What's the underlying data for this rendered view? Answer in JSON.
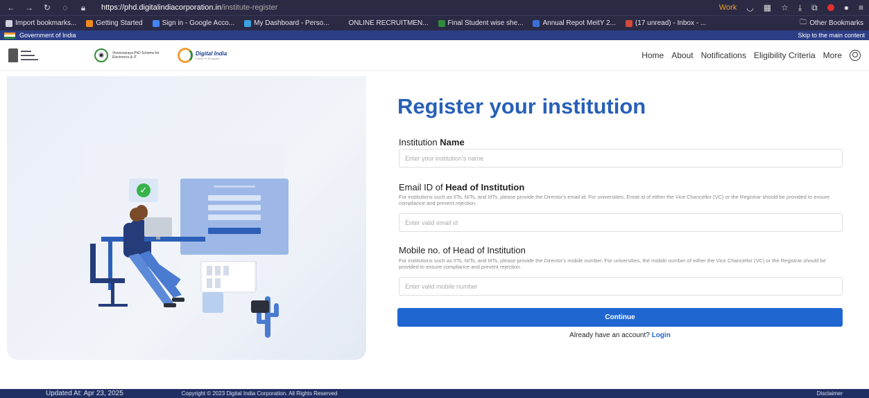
{
  "browser": {
    "url_host": "https://phd.digitalindiacorporation.in",
    "url_path": "/institute-register",
    "work_tag": "Work"
  },
  "bookmarks": [
    {
      "label": "Import bookmarks...",
      "color": "#cfcfe0"
    },
    {
      "label": "Getting Started",
      "color": "#f08a1c"
    },
    {
      "label": "Sign in - Google Acco...",
      "color": "#4285f4"
    },
    {
      "label": "My Dashboard - Perso...",
      "color": "#3aa0e0"
    },
    {
      "label": "ONLINE RECRUITMEN...",
      "color": "#2b2a45"
    },
    {
      "label": "Final Student wise she...",
      "color": "#2e8b3a"
    },
    {
      "label": "Annual Repot MeitY 2...",
      "color": "#3a6fd8"
    },
    {
      "label": "(17 unread) - Inbox - ...",
      "color": "#d34a3a"
    }
  ],
  "other_bookmarks": "Other Bookmarks",
  "gov": {
    "label": "Government of India",
    "skip": "Skip to the main content"
  },
  "header": {
    "vv_text": "Visvesvaraya PhD Scheme for Electronics & IT",
    "di_text": "Digital India",
    "di_sub": "Power To Empower",
    "nav": [
      "Home",
      "About",
      "Notifications",
      "Eligibility Criteria",
      "More"
    ]
  },
  "form": {
    "title": "Register your institution",
    "institution": {
      "label_plain": "Institution ",
      "label_bold": "Name",
      "placeholder": "Enter your institution's name"
    },
    "email": {
      "label_plain": "Email ID of ",
      "label_bold": "Head of Institution",
      "help": "For institutions such as IITs, NITs, and IIITs, please provide the Director's email id. For universities, Email id of either the Vice Chancellor (VC) or the Registrar should be provided to ensure compliance and prevent rejection.",
      "placeholder": "Enter valid email id"
    },
    "mobile": {
      "label": "Mobile no. of Head of Institution",
      "help": "For institutions such as IITs, NITs, and IIITs, please provide the Director's mobile number. For universities, the mobile number of either the Vice Chancellor (VC) or the Registrar should be provided to ensure compliance and prevent rejection.",
      "placeholder": "Enter valid mobile number"
    },
    "continue": "Continue",
    "login_prompt": "Already have an account? ",
    "login_link": "Login"
  },
  "footer": {
    "updated": "Updated At: Apr 23, 2025",
    "copyright": "Copyright © 2023 Digital India Corporation. All Rights Reserved",
    "disclaimer": "Disclaimer"
  }
}
